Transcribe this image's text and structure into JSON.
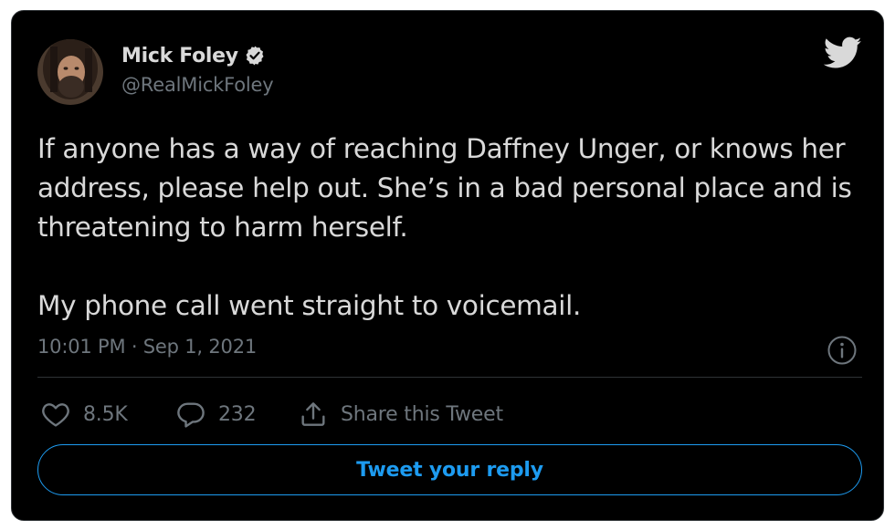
{
  "author": {
    "display_name": "Mick Foley",
    "handle": "@RealMickFoley",
    "verified": true
  },
  "tweet": {
    "paragraphs": [
      "If anyone has a way of reaching Daffney Unger, or knows her address, please help out. She’s in a bad personal place and is threatening to harm herself.",
      "My phone call went straight to voicemail."
    ],
    "timestamp": "10:01 PM · Sep 1, 2021"
  },
  "actions": {
    "likes": "8.5K",
    "replies": "232",
    "share_label": "Share this Tweet"
  },
  "reply_button_label": "Tweet your reply",
  "icons": {
    "brand": "twitter-bird-icon",
    "info": "info-icon",
    "like": "heart-icon",
    "reply": "reply-bubble-icon",
    "share": "share-icon",
    "verified": "verified-badge-icon"
  },
  "colors": {
    "background": "#000000",
    "text": "#d9d9d9",
    "secondary_text": "#6e767d",
    "accent": "#1d9bf0",
    "border": "#2f3336"
  }
}
